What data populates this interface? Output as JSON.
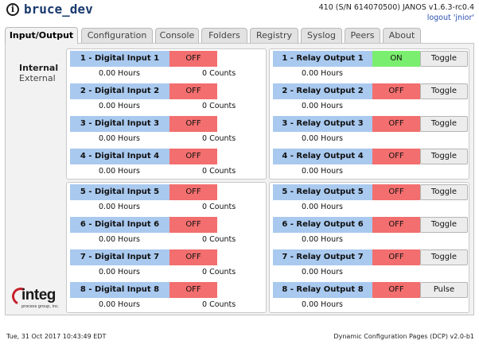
{
  "header": {
    "title": "bruce_dev",
    "version": "410 (S/N 614070500) JANOS v1.6.3-rc0.4",
    "logout": "logout 'jnior'"
  },
  "tabs": [
    "Input/Output",
    "Configuration",
    "Console",
    "Folders",
    "Registry",
    "Syslog",
    "Peers",
    "About"
  ],
  "active_tab": "Input/Output",
  "sidebar": {
    "internal": "Internal",
    "external": "External"
  },
  "inputs": [
    {
      "name": "1 - Digital Input 1",
      "state": "OFF",
      "hours": "0.00 Hours",
      "counts": "0 Counts"
    },
    {
      "name": "2 - Digital Input 2",
      "state": "OFF",
      "hours": "0.00 Hours",
      "counts": "0 Counts"
    },
    {
      "name": "3 - Digital Input 3",
      "state": "OFF",
      "hours": "0.00 Hours",
      "counts": "0 Counts"
    },
    {
      "name": "4 - Digital Input 4",
      "state": "OFF",
      "hours": "0.00 Hours",
      "counts": "0 Counts"
    },
    {
      "name": "5 - Digital Input 5",
      "state": "OFF",
      "hours": "0.00 Hours",
      "counts": "0 Counts"
    },
    {
      "name": "6 - Digital Input 6",
      "state": "OFF",
      "hours": "0.00 Hours",
      "counts": "0 Counts"
    },
    {
      "name": "7 - Digital Input 7",
      "state": "OFF",
      "hours": "0.00 Hours",
      "counts": "0 Counts"
    },
    {
      "name": "8 - Digital Input 8",
      "state": "OFF",
      "hours": "0.00 Hours",
      "counts": "0 Counts"
    }
  ],
  "outputs": [
    {
      "name": "1 - Relay Output 1",
      "state": "ON",
      "hours": "0.00 Hours",
      "button": "Toggle"
    },
    {
      "name": "2 - Relay Output 2",
      "state": "OFF",
      "hours": "0.00 Hours",
      "button": "Toggle"
    },
    {
      "name": "3 - Relay Output 3",
      "state": "OFF",
      "hours": "0.00 Hours",
      "button": "Toggle"
    },
    {
      "name": "4 - Relay Output 4",
      "state": "OFF",
      "hours": "0.00 Hours",
      "button": "Toggle"
    },
    {
      "name": "5 - Relay Output 5",
      "state": "OFF",
      "hours": "0.00 Hours",
      "button": "Toggle"
    },
    {
      "name": "6 - Relay Output 6",
      "state": "OFF",
      "hours": "0.00 Hours",
      "button": "Toggle"
    },
    {
      "name": "7 - Relay Output 7",
      "state": "OFF",
      "hours": "0.00 Hours",
      "button": "Toggle"
    },
    {
      "name": "8 - Relay Output 8",
      "state": "OFF",
      "hours": "0.00 Hours",
      "button": "Pulse"
    }
  ],
  "logo": {
    "word": "integ",
    "sub": "process group, inc."
  },
  "footer": {
    "date": "Tue, 31 Oct 2017 10:43:49 EDT",
    "dcp": "Dynamic Configuration Pages (DCP) v2.0-b1"
  },
  "colors": {
    "off": "#f36e6e",
    "on": "#7aee6e",
    "label": "#a9c9ef",
    "title": "#1a3a6e"
  }
}
